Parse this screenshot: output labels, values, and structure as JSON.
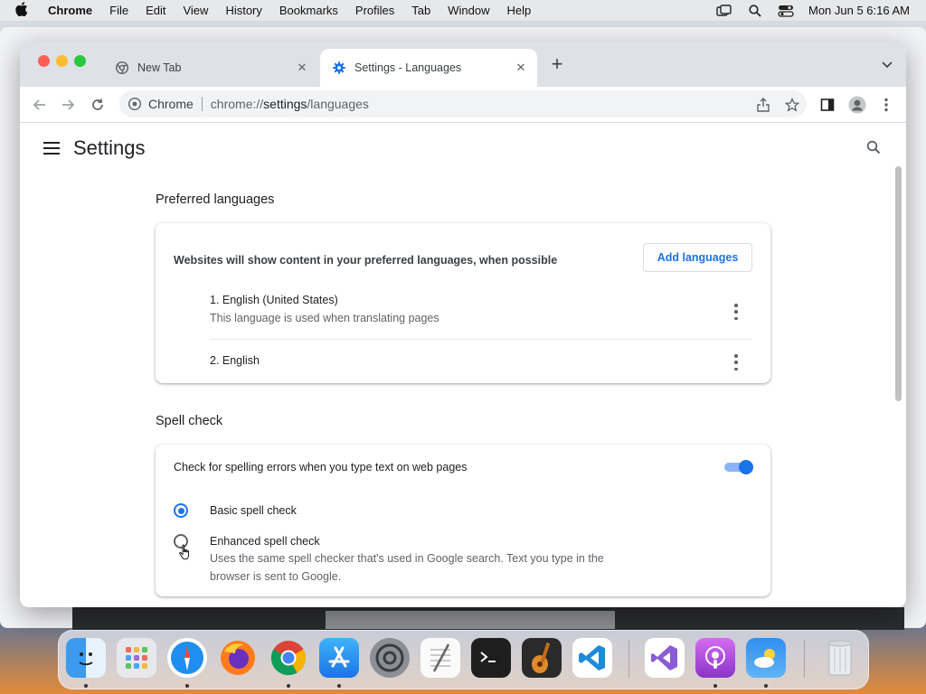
{
  "menubar": {
    "app_name": "Chrome",
    "items": [
      "File",
      "Edit",
      "View",
      "History",
      "Bookmarks",
      "Profiles",
      "Tab",
      "Window",
      "Help"
    ],
    "clock": "Mon Jun 5  6:16 AM"
  },
  "tabs": [
    {
      "title": "New Tab",
      "active": false,
      "icon": "chrome-icon"
    },
    {
      "title": "Settings - Languages",
      "active": true,
      "icon": "gear-icon"
    }
  ],
  "toolbar": {
    "site_label": "Chrome",
    "url_prefix": "chrome://",
    "url_host": "settings",
    "url_path": "/languages"
  },
  "settings": {
    "title": "Settings",
    "preferred_languages": {
      "heading": "Preferred languages",
      "description": "Websites will show content in your preferred languages, when possible",
      "add_button": "Add languages",
      "languages": [
        {
          "name": "1. English (United States)",
          "note": "This language is used when translating pages"
        },
        {
          "name": "2. English",
          "note": ""
        }
      ]
    },
    "spell_check": {
      "heading": "Spell check",
      "toggle_label": "Check for spelling errors when you type text on web pages",
      "toggle_on": true,
      "options": [
        {
          "label": "Basic spell check",
          "description": "",
          "selected": true
        },
        {
          "label": "Enhanced spell check",
          "description": "Uses the same spell checker that's used in Google search. Text you type in the browser is sent to Google.",
          "selected": false
        }
      ]
    }
  },
  "dock": {
    "apps": [
      "finder-icon",
      "launchpad-icon",
      "safari-icon",
      "firefox-icon",
      "chrome-icon",
      "app-store-icon",
      "system-preferences-icon",
      "textedit-icon",
      "terminal-icon",
      "garageband-icon",
      "vscode-icon",
      "visual-studio-icon",
      "podcasts-icon",
      "weather-icon",
      "trash-icon"
    ]
  },
  "colors": {
    "accent": "#1a73e8",
    "tabstrip": "#dee1e6"
  }
}
